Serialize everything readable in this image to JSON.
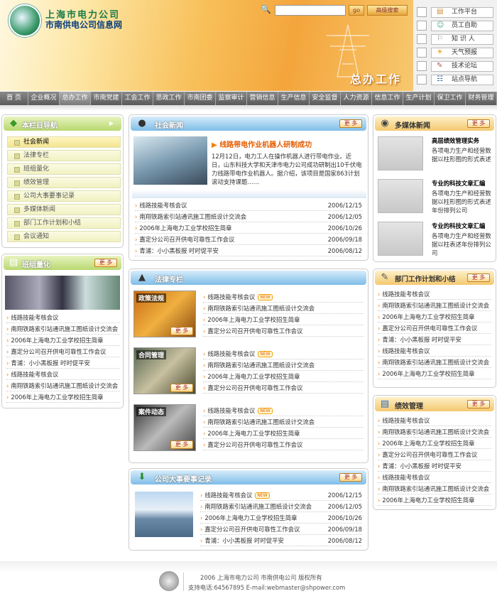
{
  "header": {
    "logo_cn": "上海市电力公司",
    "logo_sub": "市南供电公司信息网",
    "search_placeholder": "",
    "go_label": "go",
    "adv_search_label": "高级搜索",
    "banner_title": "总办工作"
  },
  "quick_links": [
    {
      "label": "工作平台",
      "icon": "monitor-icon"
    },
    {
      "label": "员工自助",
      "icon": "person-icon"
    },
    {
      "label": "知 识 人",
      "icon": "search-person-icon"
    },
    {
      "label": "天气预报",
      "icon": "weather-icon"
    },
    {
      "label": "技术论坛",
      "icon": "pencil-icon"
    },
    {
      "label": "站点导航",
      "icon": "sitemap-icon"
    }
  ],
  "nav": [
    "首 页",
    "企业概况",
    "总办工作",
    "市南党建",
    "工会工作",
    "思政工作",
    "市南团委",
    "监察审计",
    "营销信息",
    "生产信息",
    "安全监督",
    "人力资源",
    "信息工作",
    "生产计划",
    "保卫工作",
    "财务管理"
  ],
  "nav_active_index": 2,
  "left_nav": {
    "title": "本栏目导航",
    "items": [
      "社会新闻",
      "法律专栏",
      "班组量化",
      "绩效管理",
      "公司大事要事记录",
      "多媒体新闻",
      "部门工作计划和小结",
      "会议通知"
    ],
    "selected_index": 0
  },
  "banzu": {
    "title": "班组量化",
    "more": "更 多",
    "items": [
      "线路技能考核会议",
      "南翔铁路索引站通讯施工图纸设计交流会",
      "2006年上海电力工业学校招生简章",
      "嘉定分公司召开供电可靠性工作会议",
      "青浦：小小黑板报 时时促平安",
      "线路技能考核会议",
      "南翔铁路索引站通讯施工图纸设计交流会",
      "2006年上海电力工业学校招生简章"
    ]
  },
  "social_news": {
    "title": "社会新闻",
    "more": "更 多",
    "headline": "线路带电作业机器人研制成功",
    "summary": "12月12日，电力工人在操作机器人进行带电作业。近日，山东科技大学和天津市电力公司成功研制出10千伏电力线路带电作业机器人。据介绍，该项目是国家863计划滚动支持课题……",
    "items": [
      {
        "text": "线路技能考核会议",
        "date": "2006/12/15"
      },
      {
        "text": "南翔铁路索引站通讯施工图纸设计交流会",
        "date": "2006/12/05"
      },
      {
        "text": "2006年上海电力工业学校招生简章",
        "date": "2006/10/26"
      },
      {
        "text": "嘉定分公司召开供电可靠性工作会议",
        "date": "2006/09/18"
      },
      {
        "text": "青浦：小小黑板报 时时促平安",
        "date": "2006/08/12"
      }
    ]
  },
  "law": {
    "title": "法律专栏",
    "blocks": [
      {
        "image_label": "政策法规",
        "more": "更 多",
        "items": [
          "线路技能考核会议",
          "南翔铁路索引站通讯施工图纸设计交流会",
          "2006年上海电力工业学校招生简章",
          "嘉定分公司召开供电可靠性工作会议"
        ]
      },
      {
        "image_label": "合同管理",
        "more": "更 多",
        "items": [
          "线路技能考核会议",
          "南翔铁路索引站通讯施工图纸设计交流会",
          "2006年上海电力工业学校招生简章",
          "嘉定分公司召开供电可靠性工作会议"
        ]
      },
      {
        "image_label": "案件动态",
        "more": "更 多",
        "items": [
          "线路技能考核会议",
          "南翔铁路索引站通讯施工图纸设计交流会",
          "2006年上海电力工业学校招生简章",
          "嘉定分公司召开供电可靠性工作会议"
        ]
      }
    ],
    "new_badge": "NEW"
  },
  "events": {
    "title": "公司大事要事记录",
    "more": "更 多",
    "items": [
      {
        "text": "线路技能考核会议",
        "date": "2006/12/15"
      },
      {
        "text": "南翔铁路索引站通讯施工图纸设计交流会",
        "date": "2006/12/05"
      },
      {
        "text": "2006年上海电力工业学校招生简章",
        "date": "2006/10/26"
      },
      {
        "text": "嘉定分公司召开供电可靠性工作会议",
        "date": "2006/09/18"
      },
      {
        "text": "青浦：小小黑板报 时时促平安",
        "date": "2006/08/12"
      }
    ]
  },
  "multimedia": {
    "title": "多媒体新闻",
    "more": "更 多",
    "items": [
      {
        "title": "高层绩效管理实务",
        "text": "各项电力生产和经营数据以柱形图的形式表述"
      },
      {
        "title": "专业的科技文章汇编",
        "text": "各项电力生产和经营数据以柱形图的形式表述年份排列公司"
      },
      {
        "title": "专业的科技文章汇编",
        "text": "各项电力生产和经营数据以柱表述年份排列公司"
      }
    ]
  },
  "dept_plan": {
    "title": "部门工作计划和小结",
    "more": "更 多",
    "items": [
      "线路技能考核会议",
      "南翔铁路索引站通讯施工图纸设计交流会",
      "2006年上海电力工业学校招生简章",
      "嘉定分公司召开供电可靠性工作会议",
      "青浦：小小黑板报 时时促平安",
      "线路技能考核会议",
      "南翔铁路索引站通讯施工图纸设计交流会",
      "2006年上海电力工业学校招生简章"
    ]
  },
  "performance": {
    "title": "绩效管理",
    "more": "更 多",
    "items": [
      "线路技能考核会议",
      "南翔铁路索引站通讯施工图纸设计交流会",
      "2006年上海电力工业学校招生简章",
      "嘉定分公司召开供电可靠性工作会议",
      "青浦：小小黑板报 时时促平安",
      "线路技能考核会议",
      "南翔铁路索引站通讯施工图纸设计交流会",
      "2006年上海电力工业学校招生简章"
    ]
  },
  "footer": {
    "line1": "2006 上海市电力公司 市南供电公司 版权所有",
    "line2": "支持电话:64567895 E-mail:webmaster@shpower.com"
  },
  "colors": {
    "brand_green": "#1a7a4a",
    "nav_gray": "#6a6a6a",
    "accent_orange": "#f08000",
    "headline_orange": "#e65c00"
  }
}
